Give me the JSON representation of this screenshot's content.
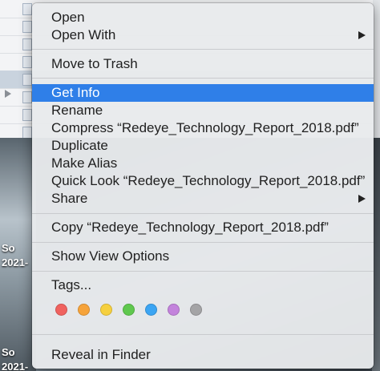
{
  "background": {
    "desktop_labels": [
      {
        "text": "So"
      },
      {
        "text": "2021-"
      },
      {
        "text": "So"
      },
      {
        "text": "2021-"
      }
    ]
  },
  "menu": {
    "open": "Open",
    "open_with": "Open With",
    "move_to_trash": "Move to Trash",
    "get_info": "Get Info",
    "rename": "Rename",
    "compress": "Compress “Redeye_Technology_Report_2018.pdf”",
    "duplicate": "Duplicate",
    "make_alias": "Make Alias",
    "quick_look": "Quick Look “Redeye_Technology_Report_2018.pdf”",
    "share": "Share",
    "copy": "Copy “Redeye_Technology_Report_2018.pdf”",
    "show_view_options": "Show View Options",
    "tags": "Tags...",
    "reveal_in_finder": "Reveal in Finder"
  },
  "tag_colors": [
    {
      "name": "red",
      "color": "#f0625f"
    },
    {
      "name": "orange",
      "color": "#f6a33a"
    },
    {
      "name": "yellow",
      "color": "#f6d03f"
    },
    {
      "name": "green",
      "color": "#5fc84e"
    },
    {
      "name": "blue",
      "color": "#3ba5f3"
    },
    {
      "name": "purple",
      "color": "#c383dc"
    },
    {
      "name": "gray",
      "color": "#a4a4a6"
    }
  ],
  "highlight_color": "#2f7fe8"
}
